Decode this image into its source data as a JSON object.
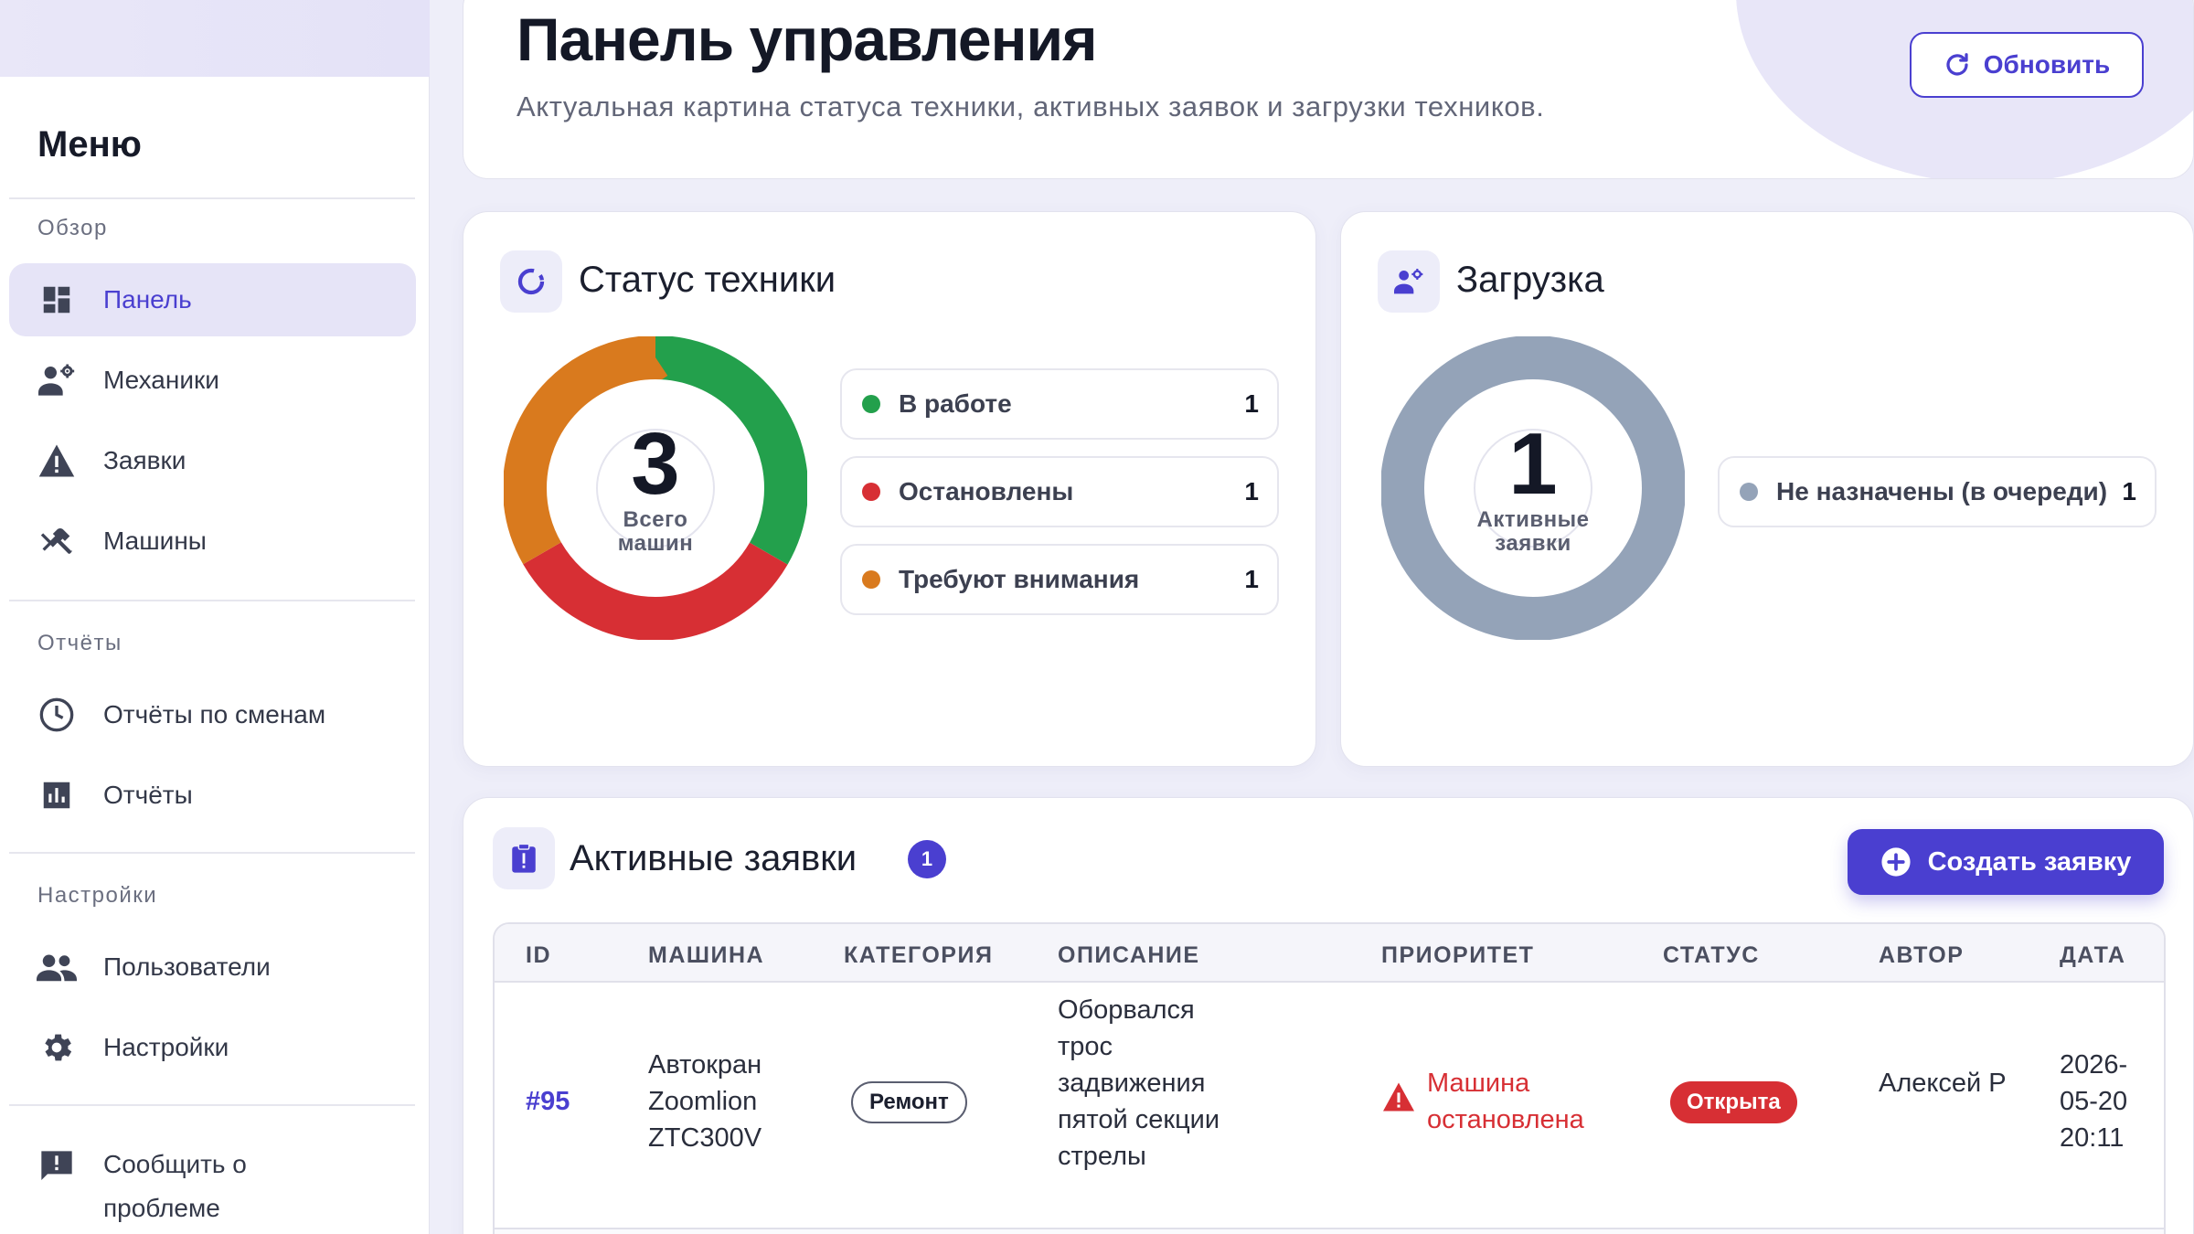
{
  "sidebar": {
    "title": "Меню",
    "sections": {
      "overview": "Обзор",
      "reports": "Отчёты",
      "settings": "Настройки"
    },
    "items": {
      "dashboard": "Панель",
      "mechanics": "Механики",
      "requests": "Заявки",
      "machines": "Машины",
      "shift_reports": "Отчёты по сменам",
      "reports": "Отчёты",
      "users": "Пользователи",
      "settings": "Настройки",
      "report_problem": "Сообщить о проблеме"
    },
    "active_item": "dashboard"
  },
  "header": {
    "title": "Панель управления",
    "subtitle": "Актуальная картина статуса техники, активных заявок и загрузки техников.",
    "refresh_label": "Обновить"
  },
  "equipment_status": {
    "title": "Статус техники",
    "total": "3",
    "total_caption_1": "Всего",
    "total_caption_2": "машин",
    "segments": [
      {
        "label": "В работе",
        "value": 1,
        "value_text": "1",
        "color": "#23a04c"
      },
      {
        "label": "Остановлены",
        "value": 1,
        "value_text": "1",
        "color": "#d72f34"
      },
      {
        "label": "Требуют внимания",
        "value": 1,
        "value_text": "1",
        "color": "#d97a1e"
      }
    ]
  },
  "workload": {
    "title": "Загрузка",
    "total": "1",
    "total_caption_1": "Активные",
    "total_caption_2": "заявки",
    "segments": [
      {
        "label": "Не назначены (в очереди)",
        "value": 1,
        "value_text": "1",
        "color": "#94a3b8"
      }
    ]
  },
  "active_requests": {
    "title": "Активные заявки",
    "count": "1",
    "create_label": "Создать заявку",
    "columns": {
      "id": "ID",
      "machine": "МАШИНА",
      "category": "КАТЕГОРИЯ",
      "description": "ОПИСАНИЕ",
      "priority": "ПРИОРИТЕТ",
      "status": "СТАТУС",
      "author": "АВТОР",
      "date": "ДАТА"
    },
    "rows": [
      {
        "id": "#95",
        "machine": "Автокран Zoomlion ZTC300V",
        "category": "Ремонт",
        "description": "Оборвался трос задвижения пятой секции стрелы",
        "priority": "Машина остановлена",
        "status": "Открыта",
        "author": "Алексей Р",
        "date": "2026-05-20 20:11"
      }
    ]
  },
  "colors": {
    "accent": "#4a3fd0",
    "danger": "#d72f34",
    "ok": "#23a04c",
    "warn": "#d97a1e",
    "neutral": "#94a3b8"
  }
}
